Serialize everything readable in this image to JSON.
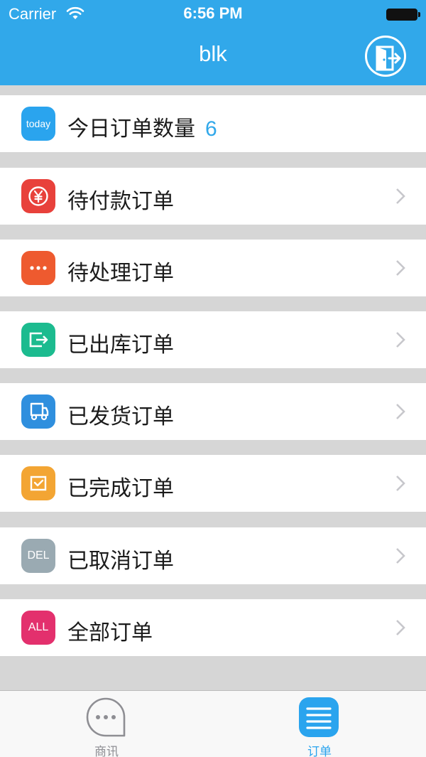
{
  "status_bar": {
    "carrier": "Carrier",
    "time": "6:56 PM"
  },
  "nav": {
    "title": "blk"
  },
  "today": {
    "label": "今日订单数量",
    "count": "6",
    "icon_text": "today",
    "icon_color": "#2aa4ee"
  },
  "orders": [
    {
      "label": "待付款订单",
      "icon": "yen-icon",
      "color": "#e8413b"
    },
    {
      "label": "待处理订单",
      "icon": "more-icon",
      "color": "#ee5a2f"
    },
    {
      "label": "已出库订单",
      "icon": "export-icon",
      "color": "#1cbb8f"
    },
    {
      "label": "已发货订单",
      "icon": "truck-icon",
      "color": "#2f8fde"
    },
    {
      "label": "已完成订单",
      "icon": "check-box-icon",
      "color": "#f3a533"
    },
    {
      "label": "已取消订单",
      "icon": "del-icon",
      "color": "#9aaab2",
      "icon_text": "DEL"
    },
    {
      "label": "全部订单",
      "icon": "all-icon",
      "color": "#e3306d",
      "icon_text": "ALL"
    }
  ],
  "tabbar": {
    "messages_label": "商讯",
    "orders_label": "订单",
    "active_color": "#2aa4ee",
    "inactive_color": "#8e8e93"
  }
}
